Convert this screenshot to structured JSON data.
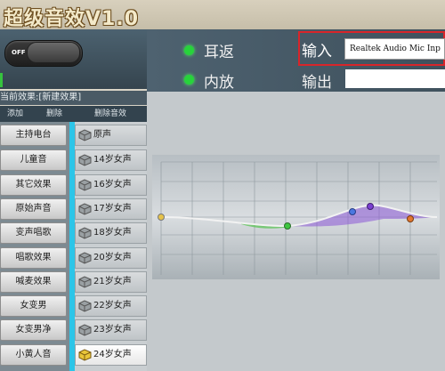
{
  "title": "超级音效V1.0",
  "toggle": {
    "label": "OFF"
  },
  "current_effect": "当前效果:[新建效果]",
  "list_header": {
    "add": "添加",
    "delete": "删除",
    "delete_effect": "删除音效"
  },
  "effects": [
    "主持电台",
    "儿童音",
    "其它效果",
    "原始声音",
    "变声唱歌",
    "唱歌效果",
    "喊麦效果",
    "女变男",
    "女变男净",
    "小黄人音"
  ],
  "presets": [
    "原声",
    "14岁女声",
    "16岁女声",
    "17岁女声",
    "18岁女声",
    "20岁女声",
    "21岁女声",
    "22岁女声",
    "23岁女声",
    "24岁女声"
  ],
  "active_preset": "24岁女声",
  "controls": {
    "ear_return": "耳返",
    "internal_playback": "内放",
    "input_label": "输入",
    "input_device": "Realtek Audio Mic Inp",
    "output_label": "输出"
  },
  "colors": {
    "indicator": "#27d33b",
    "accent_bar": "#2cc5e8",
    "highlight_border": "#d8252a"
  }
}
